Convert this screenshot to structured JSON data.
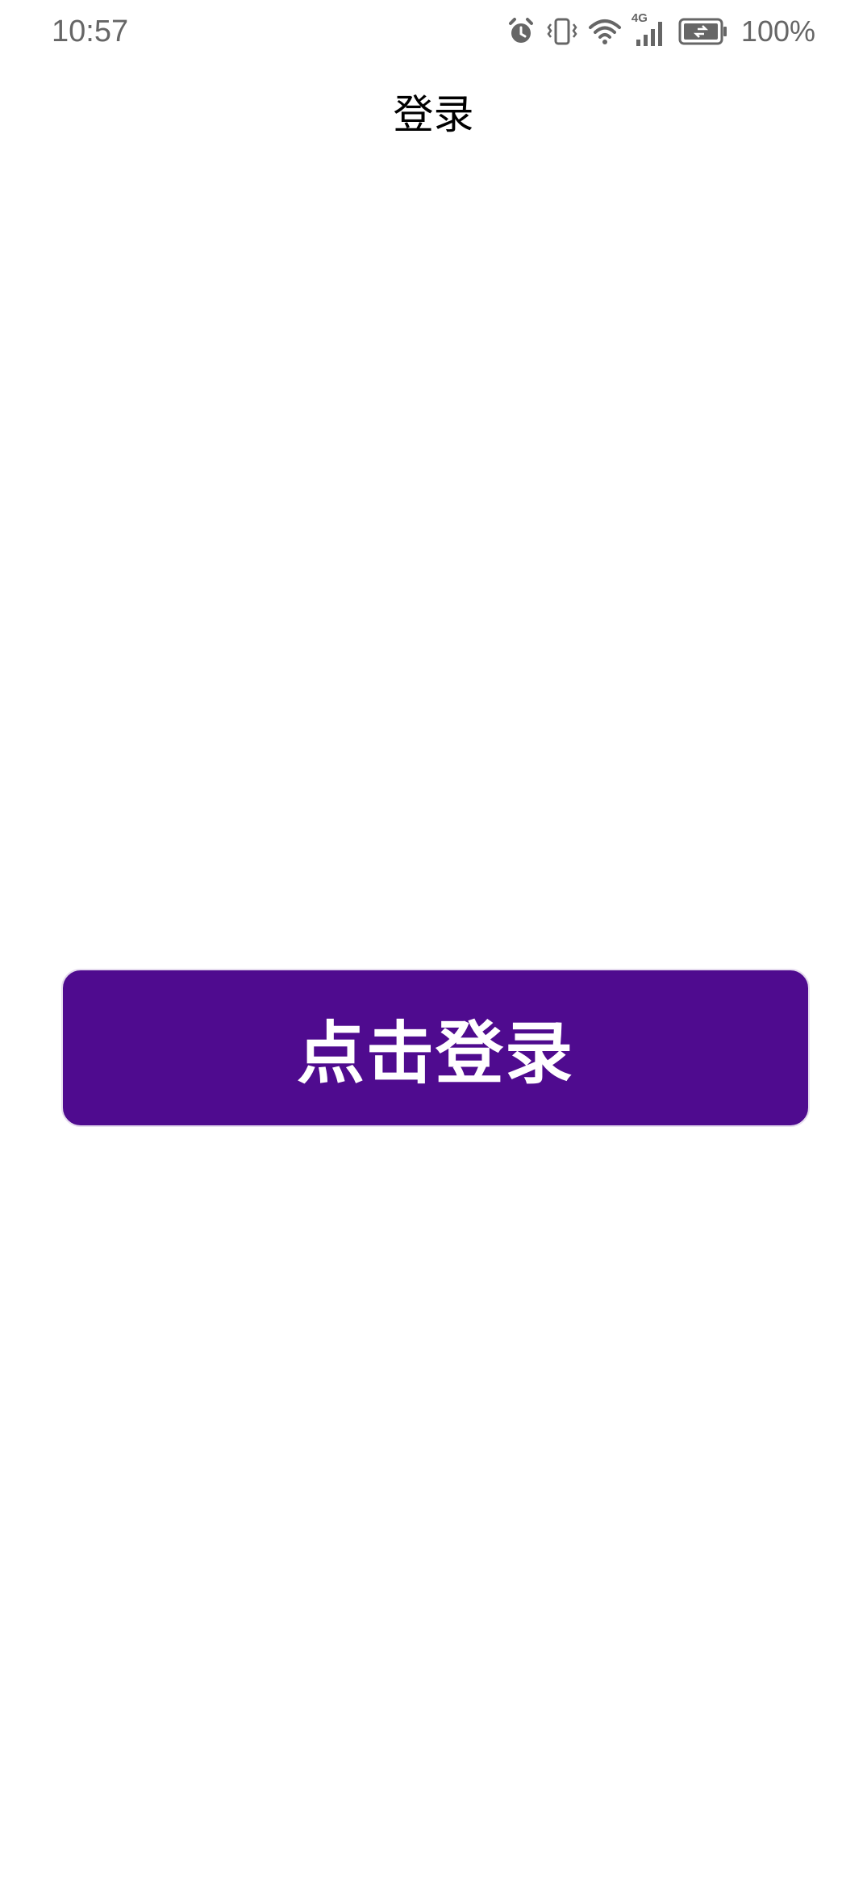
{
  "status_bar": {
    "time": "10:57",
    "network_label": "4G",
    "battery_text": "100%",
    "icons": [
      "alarm-icon",
      "vibrate-icon",
      "wifi-icon",
      "cellular-signal-icon",
      "battery-icon"
    ]
  },
  "header": {
    "title": "登录"
  },
  "main": {
    "login_button_label": "点击登录"
  },
  "colors": {
    "primary": "#4f0b8f",
    "status_text": "#666666",
    "title_text": "#000000",
    "background": "#ffffff"
  }
}
